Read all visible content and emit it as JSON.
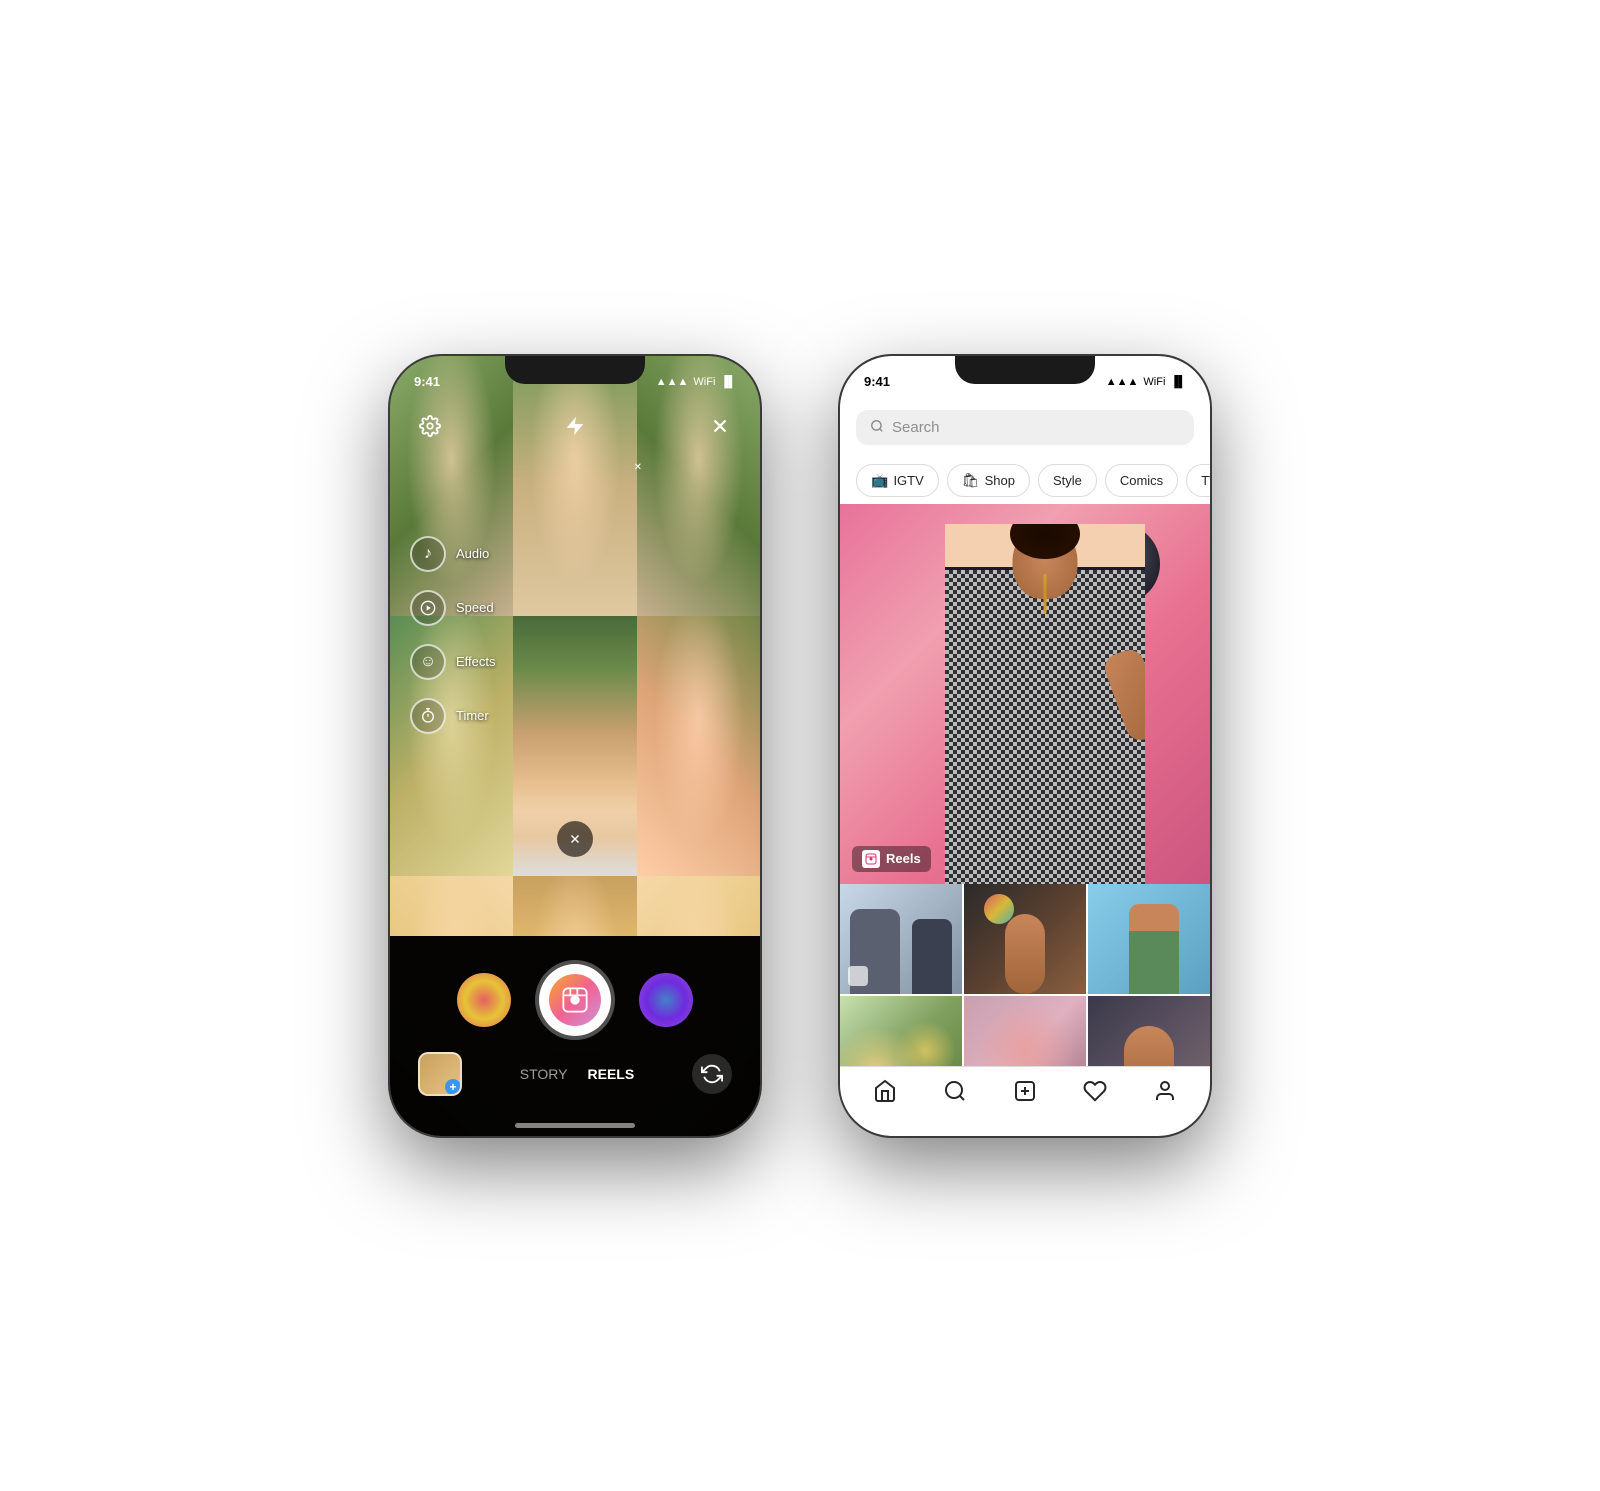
{
  "phone1": {
    "status": {
      "time": "9:41",
      "signal": "▲▲▲",
      "wifi": "WiFi",
      "battery": "■■■"
    },
    "camera": {
      "settings_icon": "⚙",
      "flash_icon": "⚡",
      "close_icon": "✕",
      "audio_label": "Audio",
      "speed_label": "Speed",
      "effects_label": "Effects",
      "timer_label": "Timer",
      "story_label": "STORY",
      "reels_label": "REELS"
    }
  },
  "phone2": {
    "status": {
      "time": "9:41"
    },
    "explore": {
      "search_placeholder": "Search",
      "categories": [
        {
          "icon": "📺",
          "label": "IGTV"
        },
        {
          "icon": "🛍",
          "label": "Shop"
        },
        {
          "icon": "",
          "label": "Style"
        },
        {
          "icon": "",
          "label": "Comics"
        },
        {
          "icon": "",
          "label": "TV & Movie"
        }
      ],
      "reels_label": "Reels"
    }
  }
}
